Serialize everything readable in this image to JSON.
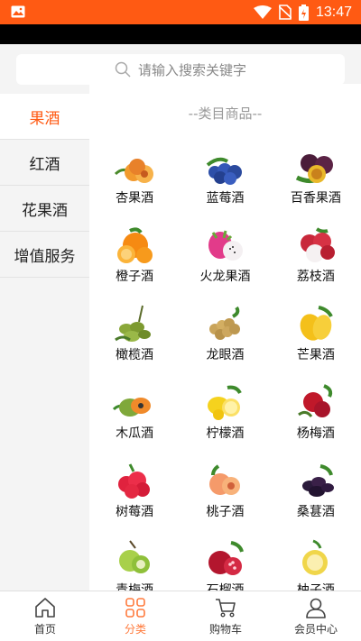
{
  "statusbar": {
    "time": "13:47"
  },
  "search": {
    "placeholder": "请输入搜索关键字"
  },
  "sidebar": {
    "items": [
      {
        "label": "果酒",
        "active": true
      },
      {
        "label": "红酒"
      },
      {
        "label": "花果酒"
      },
      {
        "label": "增值服务"
      }
    ]
  },
  "main": {
    "section_title": "--类目商品--",
    "products": [
      {
        "name": "杏果酒",
        "icon": "apricot-icon"
      },
      {
        "name": "蓝莓酒",
        "icon": "blueberry-icon"
      },
      {
        "name": "百香果酒",
        "icon": "passionfruit-icon"
      },
      {
        "name": "橙子酒",
        "icon": "orange-icon"
      },
      {
        "name": "火龙果酒",
        "icon": "dragonfruit-icon"
      },
      {
        "name": "荔枝酒",
        "icon": "lychee-icon"
      },
      {
        "name": "橄榄酒",
        "icon": "olive-icon"
      },
      {
        "name": "龙眼酒",
        "icon": "longan-icon"
      },
      {
        "name": "芒果酒",
        "icon": "mango-icon"
      },
      {
        "name": "木瓜酒",
        "icon": "papaya-icon"
      },
      {
        "name": "柠檬酒",
        "icon": "lemon-icon"
      },
      {
        "name": "杨梅酒",
        "icon": "bayberry-icon"
      },
      {
        "name": "树莓酒",
        "icon": "raspberry-icon"
      },
      {
        "name": "桃子酒",
        "icon": "peach-icon"
      },
      {
        "name": "桑葚酒",
        "icon": "mulberry-icon"
      },
      {
        "name": "青梅酒",
        "icon": "greenplum-icon"
      },
      {
        "name": "石榴酒",
        "icon": "pomegranate-icon"
      },
      {
        "name": "柚子酒",
        "icon": "pomelo-icon"
      }
    ]
  },
  "tabbar": {
    "items": [
      {
        "label": "首页",
        "icon": "home-icon"
      },
      {
        "label": "分类",
        "icon": "category-icon",
        "active": true
      },
      {
        "label": "购物车",
        "icon": "cart-icon"
      },
      {
        "label": "会员中心",
        "icon": "member-icon"
      }
    ]
  },
  "colors": {
    "accent": "#ff5a13",
    "tab_active": "#ff7a3c"
  }
}
